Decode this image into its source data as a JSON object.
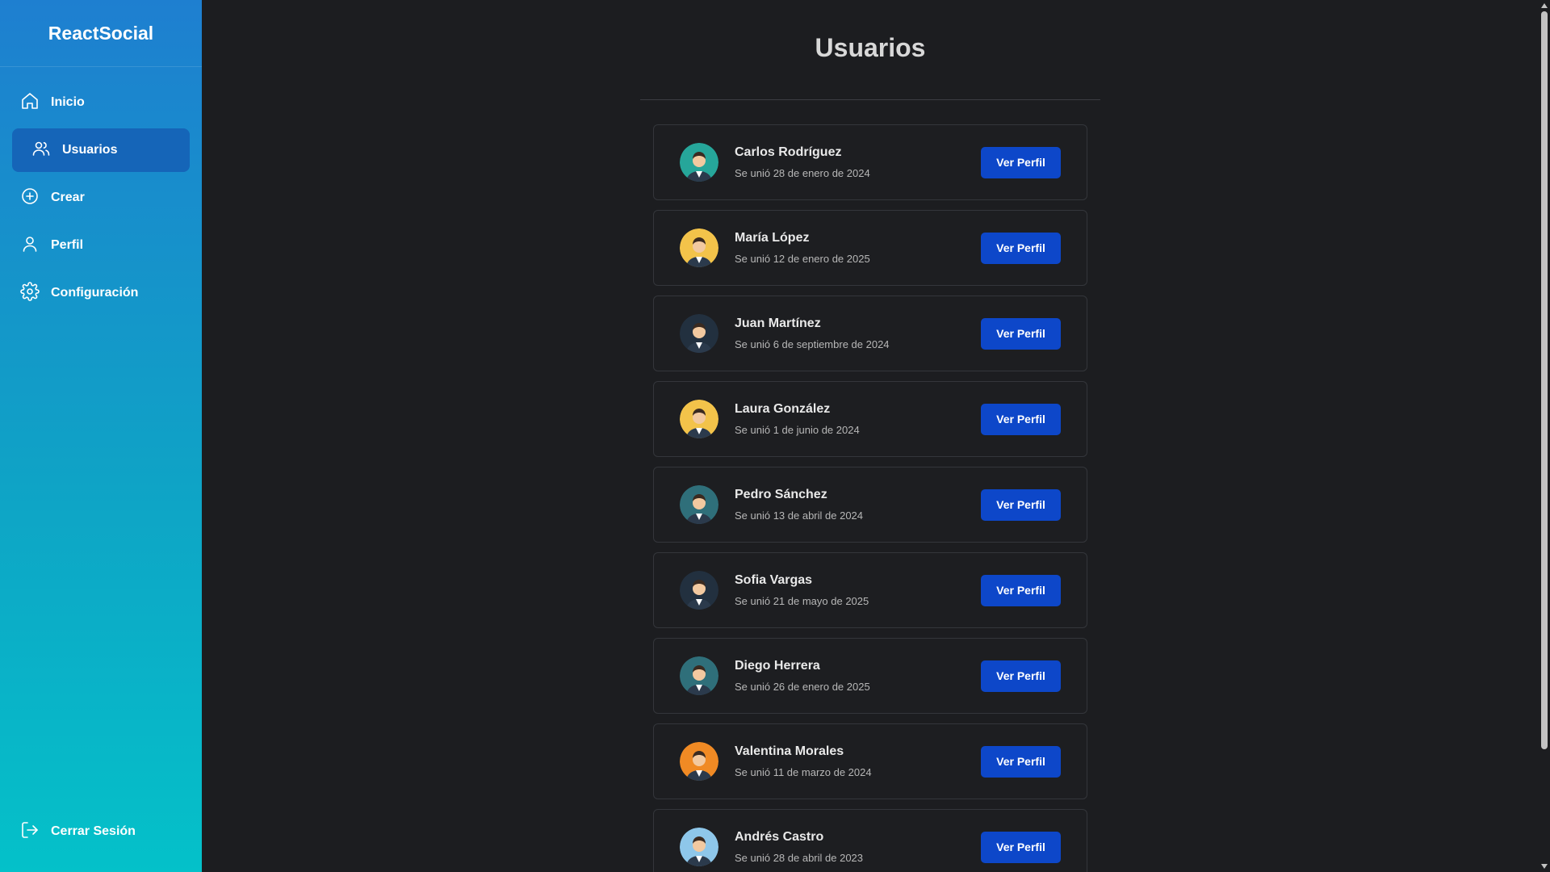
{
  "brand": "ReactSocial",
  "nav": [
    {
      "label": "Inicio",
      "icon": "home-icon"
    },
    {
      "label": "Usuarios",
      "icon": "users-icon",
      "active": true
    },
    {
      "label": "Crear",
      "icon": "plus-circle-icon"
    },
    {
      "label": "Perfil",
      "icon": "user-icon"
    },
    {
      "label": "Configuración",
      "icon": "gear-icon"
    }
  ],
  "logout": {
    "label": "Cerrar Sesión",
    "icon": "logout-icon"
  },
  "page_title": "Usuarios",
  "button_label": "Ver Perfil",
  "users": [
    {
      "name": "Carlos Rodríguez",
      "joined": "Se unió 28 de enero de 2024",
      "avatar_bg": "#26a69a"
    },
    {
      "name": "María López",
      "joined": "Se unió 12 de enero de 2025",
      "avatar_bg": "#f3c34a"
    },
    {
      "name": "Juan Martínez",
      "joined": "Se unió 6 de septiembre de 2024",
      "avatar_bg": "#22303f"
    },
    {
      "name": "Laura González",
      "joined": "Se unió 1 de junio de 2024",
      "avatar_bg": "#f3c34a"
    },
    {
      "name": "Pedro Sánchez",
      "joined": "Se unió 13 de abril de 2024",
      "avatar_bg": "#2f6f7a"
    },
    {
      "name": "Sofia Vargas",
      "joined": "Se unió 21 de mayo de 2025",
      "avatar_bg": "#22303f"
    },
    {
      "name": "Diego Herrera",
      "joined": "Se unió 26 de enero de 2025",
      "avatar_bg": "#2f6f7a"
    },
    {
      "name": "Valentina Morales",
      "joined": "Se unió 11 de marzo de 2024",
      "avatar_bg": "#f08a24"
    },
    {
      "name": "Andrés Castro",
      "joined": "Se unió 28 de abril de 2023",
      "avatar_bg": "#8ec7ea"
    }
  ],
  "colors": {
    "accent": "#0d47c9",
    "sidebar_top": "#1e7fd0",
    "sidebar_bottom": "#04c1c9",
    "background": "#1c1d20"
  }
}
